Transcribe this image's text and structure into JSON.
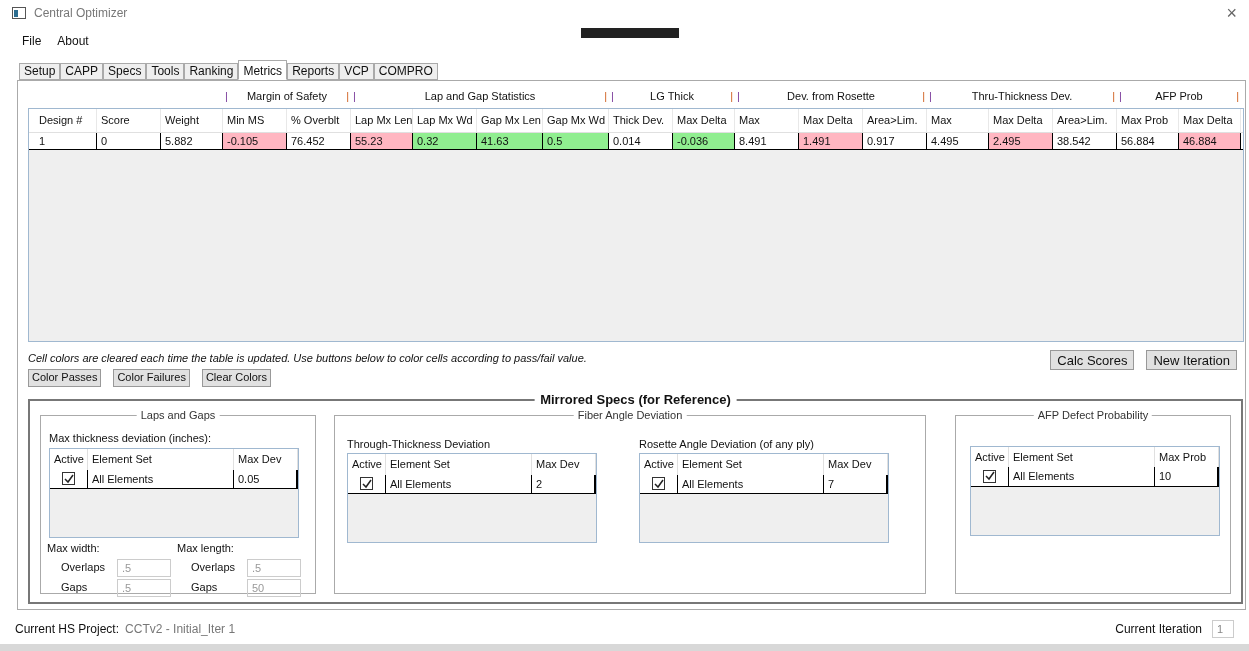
{
  "window": {
    "title": "Central Optimizer",
    "close": "×"
  },
  "menu": [
    "File",
    "About"
  ],
  "tabs": [
    {
      "label": "Setup",
      "selected": false
    },
    {
      "label": "CAPP",
      "selected": false
    },
    {
      "label": "Specs",
      "selected": false
    },
    {
      "label": "Tools",
      "selected": false
    },
    {
      "label": "Ranking",
      "selected": false
    },
    {
      "label": "Metrics",
      "selected": true
    },
    {
      "label": "Reports",
      "selected": false
    },
    {
      "label": "VCP",
      "selected": false
    },
    {
      "label": "COMPRO",
      "selected": false
    }
  ],
  "metrics_table": {
    "groups": [
      {
        "label": "Margin of Safety",
        "left": "|",
        "right": "|"
      },
      {
        "label": "Lap and Gap Statistics",
        "left": "|",
        "right": "|"
      },
      {
        "label": "LG Thick",
        "left": "|",
        "right": "|"
      },
      {
        "label": "Dev. from Rosette",
        "left": "|",
        "right": "|"
      },
      {
        "label": "Thru-Thickness Dev.",
        "left": "|",
        "right": "|"
      },
      {
        "label": "AFP Prob",
        "left": "|",
        "right": "|"
      }
    ],
    "columns": [
      "Design #",
      "Score",
      "Weight",
      "Min MS",
      "% Overblt",
      "Lap Mx Len",
      "Lap Mx Wd",
      "Gap Mx Len",
      "Gap Mx Wd",
      "Thick Dev.",
      "Max Delta",
      "Max",
      "Max Delta",
      "Area>Lim.",
      "Max",
      "Max Delta",
      "Area>Lim.",
      "Max Prob",
      "Max Delta"
    ],
    "rows": [
      [
        {
          "text": "1"
        },
        {
          "text": "0"
        },
        {
          "text": "5.882"
        },
        {
          "text": "-0.105",
          "color": "#ffb6c1"
        },
        {
          "text": "76.452"
        },
        {
          "text": "55.23",
          "color": "#ffb6c1"
        },
        {
          "text": "0.32",
          "color": "#90ee90"
        },
        {
          "text": "41.63",
          "color": "#90ee90"
        },
        {
          "text": "0.5",
          "color": "#90ee90"
        },
        {
          "text": "0.014"
        },
        {
          "text": "-0.036",
          "color": "#90ee90"
        },
        {
          "text": "8.491"
        },
        {
          "text": "1.491",
          "color": "#ffb6c1"
        },
        {
          "text": "0.917"
        },
        {
          "text": "4.495"
        },
        {
          "text": "2.495",
          "color": "#ffb6c1"
        },
        {
          "text": "38.542"
        },
        {
          "text": "56.884"
        },
        {
          "text": "46.884",
          "color": "#ffb6c1"
        }
      ]
    ]
  },
  "note": "Cell colors are cleared each time the table is updated. Use buttons below to color cells according to pass/fail value.",
  "color_buttons": [
    "Color Passes",
    "Color Failures",
    "Clear Colors"
  ],
  "action_buttons": [
    "Calc Scores",
    "New Iteration"
  ],
  "mirrored_specs": {
    "title": "Mirrored Specs (for Reference)",
    "laps_and_gaps": {
      "title": "Laps and Gaps",
      "subtitle": "Max thickness deviation (inches):",
      "grid": {
        "columns": [
          "Active",
          "Element Set",
          "Max Dev"
        ],
        "rows": [
          {
            "active": true,
            "set": "All Elements",
            "value": "0.05"
          }
        ]
      },
      "width_label": "Max width:",
      "length_label": "Max length:",
      "width_fields": [
        {
          "label": "Overlaps",
          "value": ".5",
          "disabled": true
        },
        {
          "label": "Gaps",
          "value": ".5",
          "disabled": true
        }
      ],
      "length_fields": [
        {
          "label": "Overlaps",
          "value": ".5",
          "disabled": true
        },
        {
          "label": "Gaps",
          "value": "50",
          "disabled": true
        }
      ]
    },
    "fiber_angle": {
      "title": "Fiber Angle Deviation",
      "sections": [
        {
          "subtitle": "Through-Thickness Deviation",
          "grid": {
            "columns": [
              "Active",
              "Element Set",
              "Max Dev"
            ],
            "rows": [
              {
                "active": true,
                "set": "All Elements",
                "value": "2"
              }
            ]
          }
        },
        {
          "subtitle": "Rosette Angle Deviation (of any ply)",
          "grid": {
            "columns": [
              "Active",
              "Element Set",
              "Max Dev"
            ],
            "rows": [
              {
                "active": true,
                "set": "All Elements",
                "value": "7"
              }
            ]
          }
        }
      ]
    },
    "afp": {
      "title": "AFP Defect Probability",
      "grid": {
        "columns": [
          "Active",
          "Element Set",
          "Max Prob"
        ],
        "rows": [
          {
            "active": true,
            "set": "All Elements",
            "value": "10"
          }
        ]
      }
    }
  },
  "status_bar": {
    "project_label": "Current HS Project:",
    "project": "CCTv2 - Initial_Iter 1",
    "iteration_label": "Current Iteration",
    "iteration": "1",
    "iteration_disabled": true
  }
}
